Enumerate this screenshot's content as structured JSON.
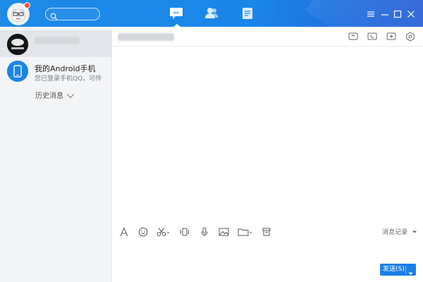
{
  "topbar": {
    "nav": [
      {
        "name": "message",
        "icon": "chat-bubble-icon",
        "active": true
      },
      {
        "name": "contacts",
        "icon": "contacts-icon",
        "active": false
      },
      {
        "name": "space",
        "icon": "document-icon",
        "active": false
      }
    ],
    "window_controls": [
      "menu-icon",
      "minimize-icon",
      "maximize-icon",
      "close-icon"
    ],
    "accent_color": "#1a86e8"
  },
  "sidebar": {
    "contacts": [
      {
        "title": "",
        "subtitle": "",
        "avatar_icon": "profile-avatar-icon",
        "active": true,
        "name_blurred": true
      },
      {
        "title": "我的Android手机",
        "subtitle": "您已登录手机QQ，可传",
        "avatar_icon": "phone-icon",
        "active": false
      }
    ],
    "history_label": "历史消息"
  },
  "chat": {
    "header_title": "",
    "header_actions": [
      "screen-share-icon",
      "voice-call-icon",
      "add-icon",
      "settings-icon"
    ],
    "toolbar": [
      "font-icon",
      "emoji-icon",
      "screenshot-icon",
      "shake-icon",
      "voice-icon",
      "image-icon",
      "folder-icon",
      "favorites-icon"
    ],
    "message_record_label": "消息记录",
    "send_label": "发送(S)"
  }
}
